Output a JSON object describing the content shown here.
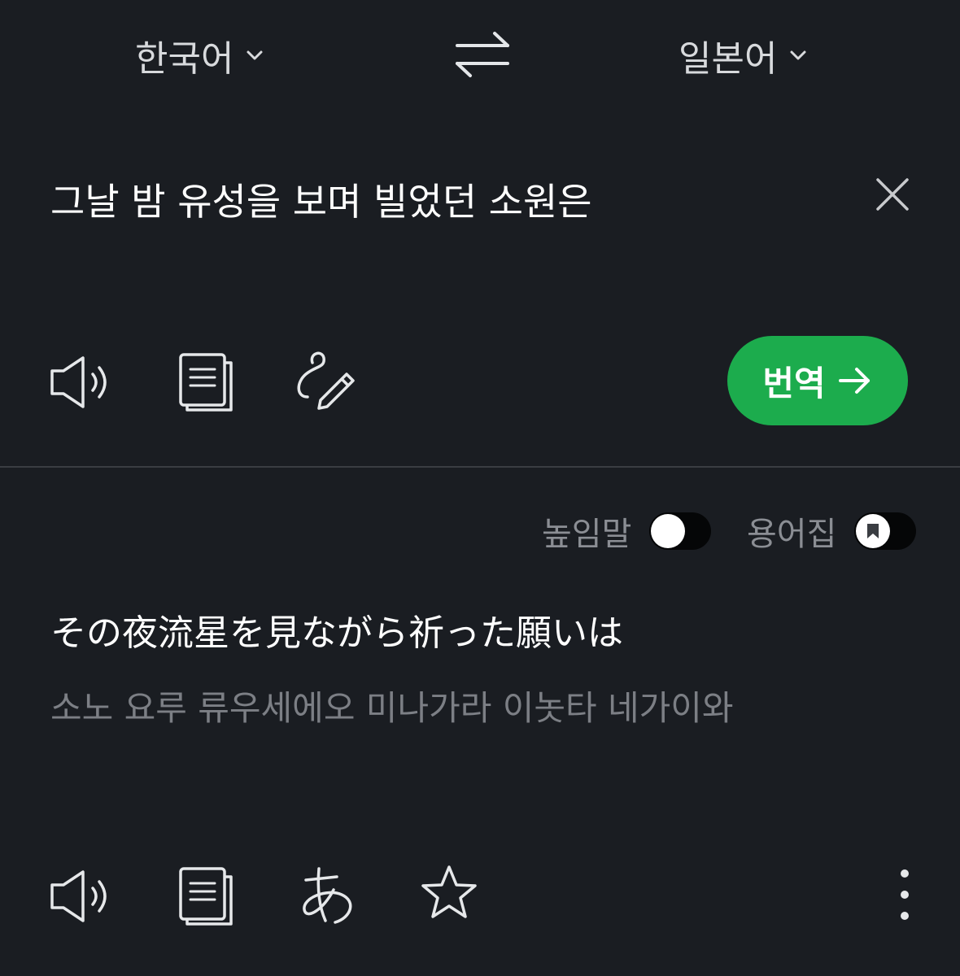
{
  "languages": {
    "source": "한국어",
    "target": "일본어"
  },
  "input": {
    "text": "그날 밤 유성을 보며 빌었던 소원은"
  },
  "translate_button": {
    "label": "번역"
  },
  "toggles": {
    "honorific_label": "높임말",
    "honorific_on": false,
    "glossary_label": "용어집",
    "glossary_on": false
  },
  "result": {
    "text": "その夜流星を見ながら祈った願いは",
    "pronunciation": "소노 요루 류우세에오 미나가라 이놋타 네가이와"
  },
  "colors": {
    "background": "#1a1d22",
    "accent": "#1cac4d",
    "muted_text": "#7c7f85"
  },
  "icons": {
    "source_row": [
      "speaker-icon",
      "copy-icon",
      "handwriting-icon"
    ],
    "result_row": [
      "speaker-icon",
      "copy-icon",
      "hiragana-icon",
      "star-icon",
      "more-vertical-icon"
    ]
  }
}
